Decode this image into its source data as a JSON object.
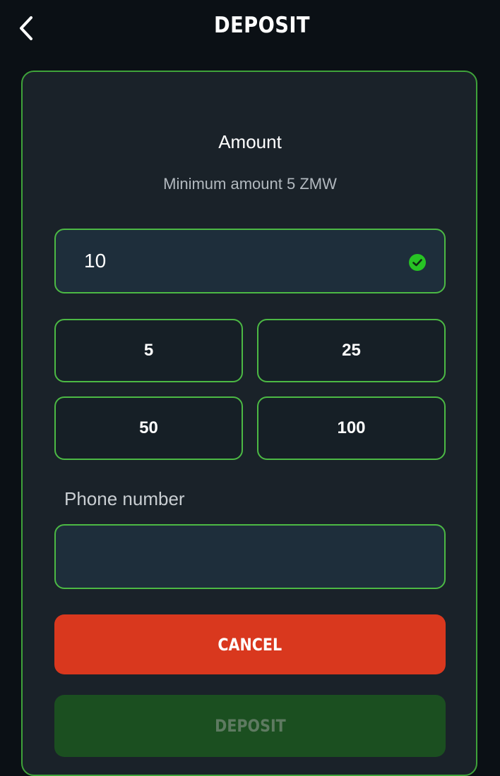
{
  "header": {
    "title": "DEPOSIT",
    "back_icon": "chevron-left-icon"
  },
  "form": {
    "amount_title": "Amount",
    "min_amount_text": "Minimum amount 5 ZMW",
    "amount_value": "10",
    "amount_valid_icon": "check-circle-icon",
    "presets": [
      "5",
      "25",
      "50",
      "100"
    ],
    "phone_label": "Phone number",
    "phone_value": ""
  },
  "actions": {
    "cancel_label": "CANCEL",
    "deposit_label": "DEPOSIT"
  },
  "colors": {
    "background": "#0b1015",
    "card": "#1a2229",
    "accent_green": "#4cb944",
    "cancel_red": "#d9381e",
    "deposit_disabled": "#1b4f20"
  }
}
